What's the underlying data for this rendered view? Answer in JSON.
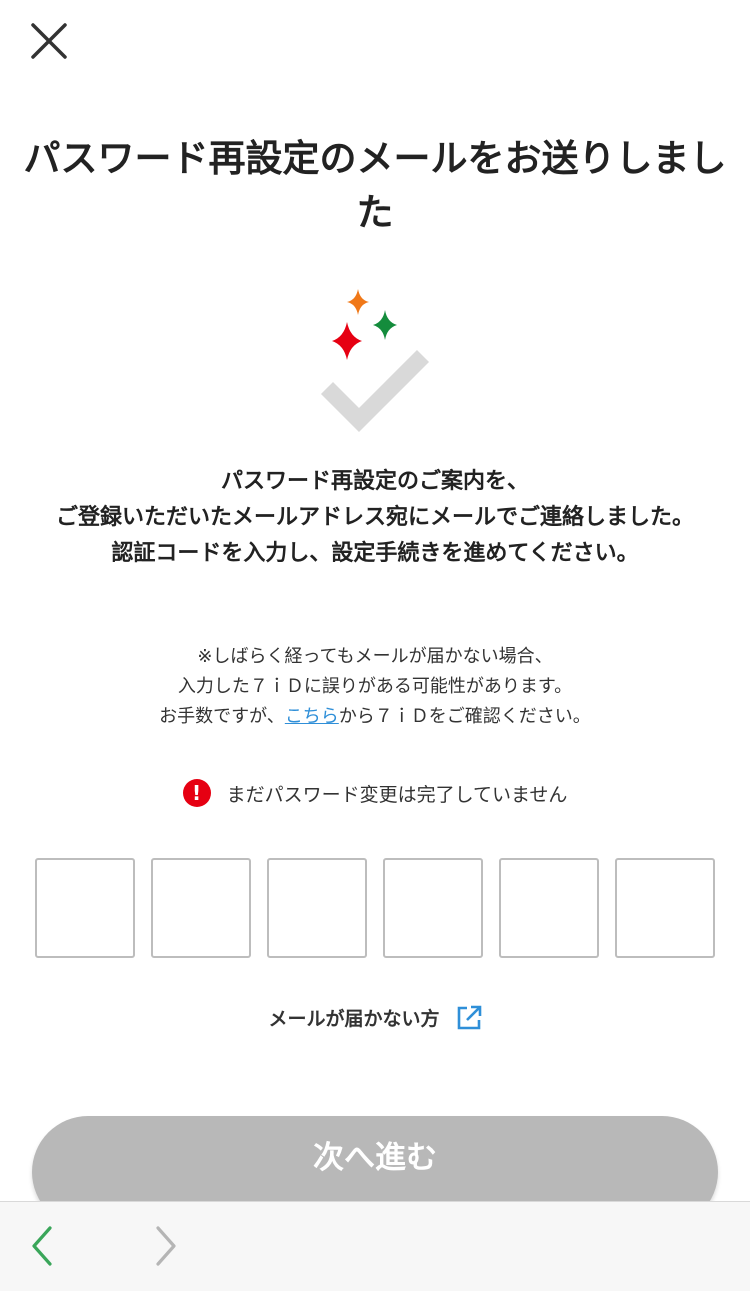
{
  "close": {
    "icon": "close-icon"
  },
  "title": "パスワード再設定のメールをお送りしました",
  "hero": {
    "icons": [
      "sparkle-icon",
      "checkmark-icon"
    ],
    "sparkle_colors": [
      "#f07818",
      "#e60012",
      "#148c3c"
    ],
    "check_color": "#d9d9d9"
  },
  "message": {
    "line1": "パスワード再設定のご案内を、",
    "line2": "ご登録いただいたメールアドレス宛にメールでご連絡しました。",
    "line3": "認証コードを入力し、設定手続きを進めてください。"
  },
  "note": {
    "line1": "※しばらく経ってもメールが届かない場合、",
    "line2": "入力した７ｉＤに誤りがある可能性があります。",
    "line3_prefix": "お手数ですが、",
    "line3_link": "こちら",
    "line3_suffix": "から７ｉＤをご確認ください。"
  },
  "warning": {
    "icon": "exclamation-icon",
    "symbol": "!",
    "text": "まだパスワード変更は完了していません",
    "color": "#e60012"
  },
  "code_inputs": [
    "",
    "",
    "",
    "",
    "",
    ""
  ],
  "no_mail": {
    "label": "メールが届かない方",
    "icon": "external-link-icon",
    "icon_color": "#2f8fd8"
  },
  "next_button": {
    "label": "次へ進む",
    "disabled": true
  },
  "browser_nav": {
    "back_icon": "chevron-left-icon",
    "forward_icon": "chevron-right-icon",
    "back_color": "#3aa65a",
    "forward_color": "#b5b5b5"
  }
}
